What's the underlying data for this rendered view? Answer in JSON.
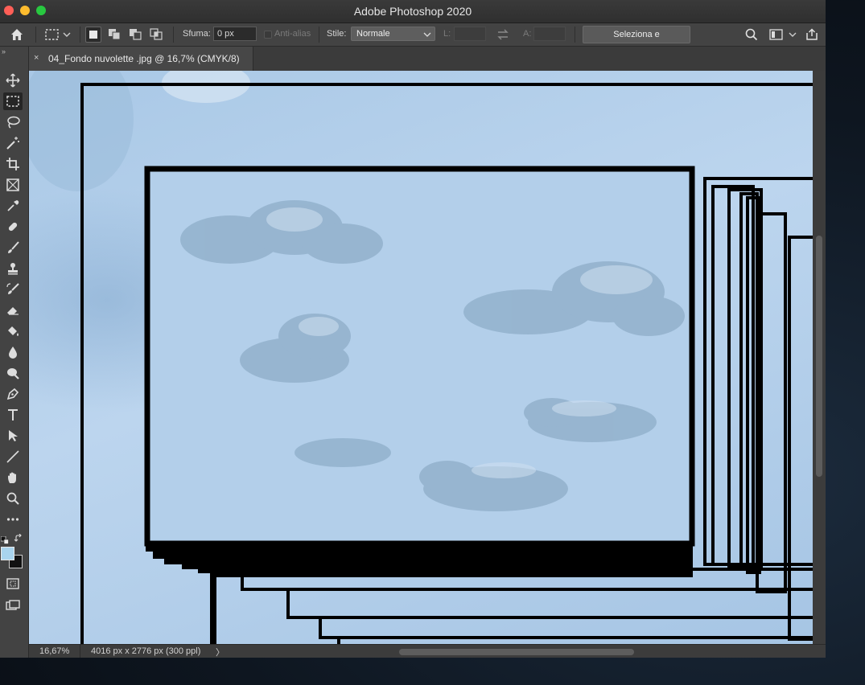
{
  "window": {
    "title": "Adobe Photoshop 2020"
  },
  "options_bar": {
    "feather_label": "Sfuma:",
    "feather_value": "0 px",
    "anti_alias_label": "Anti-alias",
    "style_label": "Stile:",
    "style_value": "Normale",
    "width_label": "L:",
    "height_label": "A:",
    "select_mask_button": "Seleziona e maschera..."
  },
  "document_tab": {
    "close_symbol": "×",
    "label": "04_Fondo nuvolette .jpg @ 16,7% (CMYK/8)"
  },
  "status_bar": {
    "zoom": "16,67%",
    "doc_info": "4016 px x 2776 px (300 ppl)",
    "arrow": "〉"
  },
  "colors": {
    "foreground": "#a9d4ee",
    "background": "#111111",
    "accent_window": "#535353"
  },
  "tools": [
    "move-tool",
    "rectangular-marquee-tool",
    "lasso-tool",
    "magic-wand-tool",
    "crop-tool",
    "frame-tool",
    "eyedropper-tool",
    "healing-brush-tool",
    "brush-tool",
    "clone-stamp-tool",
    "history-brush-tool",
    "eraser-tool",
    "paint-bucket-tool",
    "blur-tool",
    "dodge-tool",
    "pen-tool",
    "type-tool",
    "path-selection-tool",
    "line-tool",
    "hand-tool",
    "zoom-tool",
    "edit-toolbar"
  ]
}
